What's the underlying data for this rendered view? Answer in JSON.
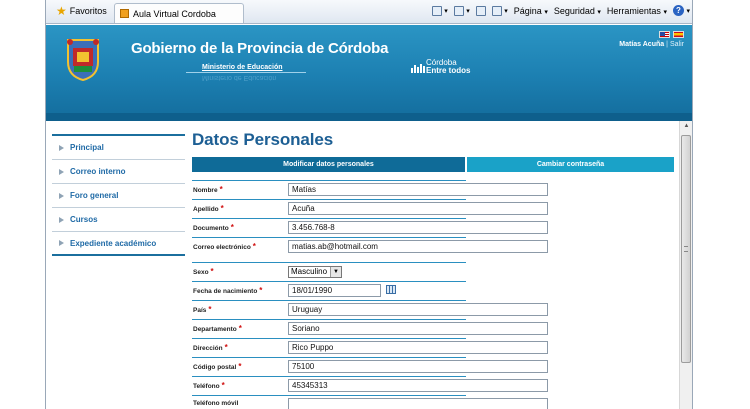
{
  "browser": {
    "favorites_label": "Favoritos",
    "tab_title": "Aula Virtual Cordoba",
    "menu_pagina": "Página",
    "menu_seguridad": "Seguridad",
    "menu_herramientas": "Herramientas"
  },
  "header": {
    "title": "Gobierno de la Provincia de Córdoba",
    "ministry": "Ministerio de Educación",
    "logo_top": "Córdoba",
    "logo_bottom": "Entre todos",
    "user_name": "Matías Acuña",
    "logout": "Salir"
  },
  "sidebar": {
    "items": [
      {
        "label": "Principal"
      },
      {
        "label": "Correo interno"
      },
      {
        "label": "Foro general"
      },
      {
        "label": "Cursos"
      },
      {
        "label": "Expediente académico"
      }
    ]
  },
  "main": {
    "title": "Datos Personales",
    "tab_edit": "Modificar datos personales",
    "tab_password": "Cambiar contraseña"
  },
  "form": {
    "nombre": {
      "label": "Nombre",
      "value": "Matías"
    },
    "apellido": {
      "label": "Apellido",
      "value": "Acuña"
    },
    "documento": {
      "label": "Documento",
      "value": "3.456.768-8"
    },
    "correo": {
      "label": "Correo electrónico",
      "value": "matias.ab@hotmail.com"
    },
    "sexo": {
      "label": "Sexo",
      "value": "Masculino"
    },
    "nacimiento": {
      "label": "Fecha de nacimiento",
      "value": "18/01/1990"
    },
    "pais": {
      "label": "País",
      "value": "Uruguay"
    },
    "departamento": {
      "label": "Departamento",
      "value": "Soriano"
    },
    "direccion": {
      "label": "Dirección",
      "value": "Rico Puppo"
    },
    "postal": {
      "label": "Código postal",
      "value": "75100"
    },
    "telefono": {
      "label": "Teléfono",
      "value": "45345313"
    },
    "movil": {
      "label": "Teléfono móvil",
      "value": ""
    }
  },
  "colors": {
    "banner": "#1c7fb1",
    "tab_active": "#0f6b98",
    "tab_inactive": "#1aa2c8",
    "link": "#1f6aa6",
    "required": "#d01010"
  }
}
